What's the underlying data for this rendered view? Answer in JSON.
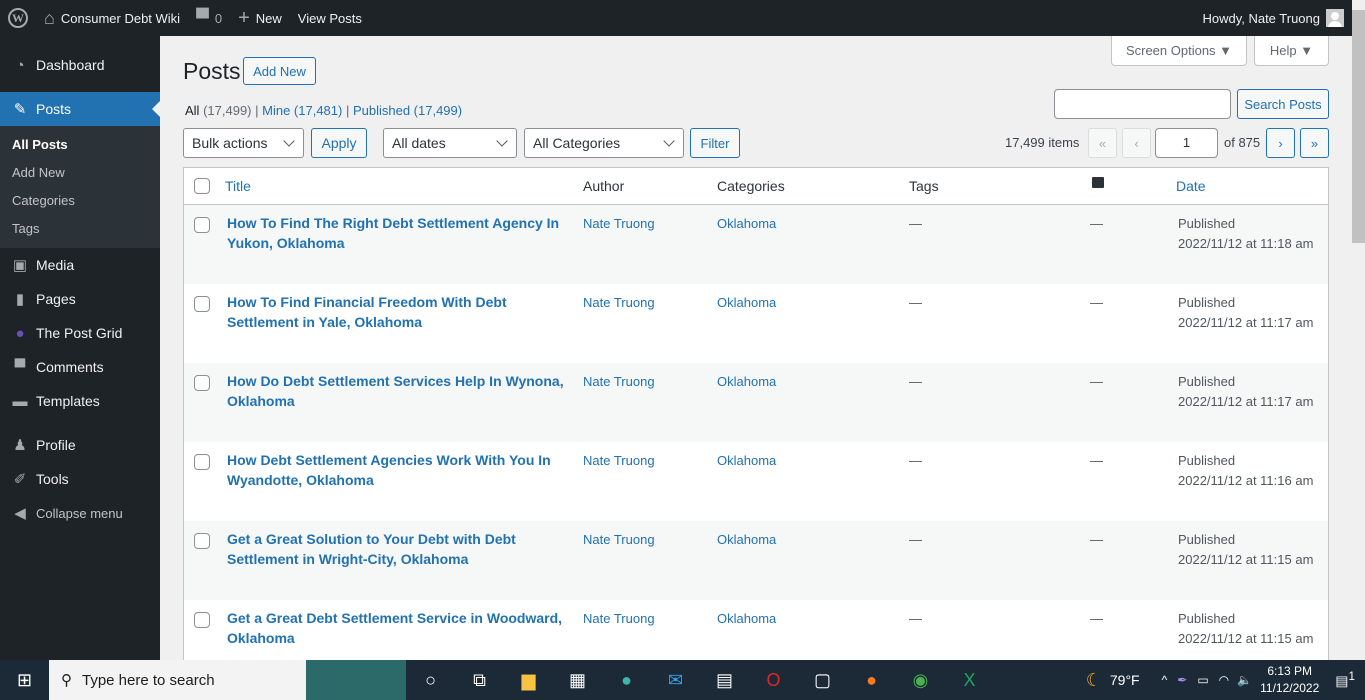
{
  "adminbar": {
    "site_name": "Consumer Debt Wiki",
    "comments_count": "0",
    "new_label": "New",
    "view_posts_label": "View Posts",
    "howdy": "Howdy, Nate Truong"
  },
  "sidebar": {
    "items": [
      {
        "label": "Dashboard",
        "icon": "dashboard-icon"
      },
      {
        "label": "Posts",
        "icon": "pin-icon",
        "current": true
      },
      {
        "label": "Media",
        "icon": "media-icon"
      },
      {
        "label": "Pages",
        "icon": "pages-icon"
      },
      {
        "label": "The Post Grid",
        "icon": "post-grid-icon"
      },
      {
        "label": "Comments",
        "icon": "comment-icon"
      },
      {
        "label": "Templates",
        "icon": "folder-icon"
      },
      {
        "label": "Profile",
        "icon": "user-icon"
      },
      {
        "label": "Tools",
        "icon": "wrench-icon"
      },
      {
        "label": "Collapse menu",
        "icon": "collapse-icon"
      }
    ],
    "submenu": [
      "All Posts",
      "Add New",
      "Categories",
      "Tags"
    ]
  },
  "header": {
    "screen_options": "Screen Options ▼",
    "help": "Help ▼",
    "title": "Posts",
    "add_new": "Add New"
  },
  "views": {
    "all": "All",
    "all_count": "(17,499)",
    "mine": "Mine (17,481)",
    "published": "Published (17,499)"
  },
  "search": {
    "value": "",
    "button": "Search Posts"
  },
  "filters": {
    "bulk": "Bulk actions",
    "apply": "Apply",
    "dates": "All dates",
    "categories": "All Categories",
    "filter": "Filter"
  },
  "pagination": {
    "items": "17,499 items",
    "first": "«",
    "prev": "‹",
    "current": "1",
    "of": "of 875",
    "next": "›",
    "last": "»"
  },
  "table": {
    "headers": {
      "title": "Title",
      "author": "Author",
      "categories": "Categories",
      "tags": "Tags",
      "date": "Date"
    },
    "rows": [
      {
        "title": "How To Find The Right Debt Settlement Agency In Yukon, Oklahoma",
        "author": "Nate Truong",
        "category": "Oklahoma",
        "tags": "—",
        "comments": "—",
        "status": "Published",
        "date": "2022/11/12 at 11:18 am"
      },
      {
        "title": "How To Find Financial Freedom With Debt Settlement in Yale, Oklahoma",
        "author": "Nate Truong",
        "category": "Oklahoma",
        "tags": "—",
        "comments": "—",
        "status": "Published",
        "date": "2022/11/12 at 11:17 am"
      },
      {
        "title": "How Do Debt Settlement Services Help In Wynona, Oklahoma",
        "author": "Nate Truong",
        "category": "Oklahoma",
        "tags": "—",
        "comments": "—",
        "status": "Published",
        "date": "2022/11/12 at 11:17 am"
      },
      {
        "title": "How Debt Settlement Agencies Work With You In Wyandotte, Oklahoma",
        "author": "Nate Truong",
        "category": "Oklahoma",
        "tags": "—",
        "comments": "—",
        "status": "Published",
        "date": "2022/11/12 at 11:16 am"
      },
      {
        "title": "Get a Great Solution to Your Debt with Debt Settlement in Wright-City, Oklahoma",
        "author": "Nate Truong",
        "category": "Oklahoma",
        "tags": "—",
        "comments": "—",
        "status": "Published",
        "date": "2022/11/12 at 11:15 am"
      },
      {
        "title": "Get a Great Debt Settlement Service in Woodward, Oklahoma",
        "author": "Nate Truong",
        "category": "Oklahoma",
        "tags": "—",
        "comments": "—",
        "status": "Published",
        "date": "2022/11/12 at 11:15 am"
      }
    ]
  },
  "taskbar": {
    "search_placeholder": "Type here to search",
    "weather": "79°F",
    "time": "6:13 PM",
    "date": "11/12/2022",
    "notifications": "1"
  }
}
